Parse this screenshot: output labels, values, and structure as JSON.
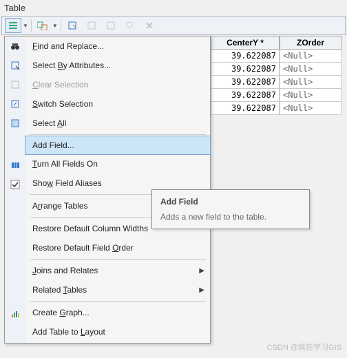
{
  "title": "Table",
  "toolbar": {
    "items": [
      {
        "name": "table-options",
        "icon": "list"
      },
      {
        "name": "related-tables",
        "icon": "related"
      },
      {
        "name": "select-by-attr",
        "icon": "select"
      },
      {
        "name": "switch-select",
        "icon": "switch"
      },
      {
        "name": "clear-select",
        "icon": "clear"
      },
      {
        "name": "zoom-select",
        "icon": "zoom"
      },
      {
        "name": "delete",
        "icon": "x"
      }
    ]
  },
  "menu": {
    "items": [
      {
        "label": "Find and Replace...",
        "icon": "binoculars",
        "key": "F"
      },
      {
        "label": "Select By Attributes...",
        "icon": "select",
        "key": "B"
      },
      {
        "label": "Clear Selection",
        "icon": "clear",
        "disabled": true,
        "key": "C"
      },
      {
        "label": "Switch Selection",
        "icon": "switch",
        "key": "S"
      },
      {
        "label": "Select All",
        "icon": "selectall",
        "key": "A"
      },
      {
        "sep": true
      },
      {
        "label": "Add Field...",
        "icon": "",
        "highlight": true
      },
      {
        "label": "Turn All Fields On",
        "icon": "fields",
        "key": "T"
      },
      {
        "label": "Show Field Aliases",
        "icon": "check",
        "checked": true,
        "key": "w"
      },
      {
        "sep": true
      },
      {
        "label": "Arrange Tables",
        "arrow": true,
        "key": "r"
      },
      {
        "sep": true
      },
      {
        "label": "Restore Default Column Widths"
      },
      {
        "label": "Restore Default Field Order",
        "key": "O"
      },
      {
        "sep": true
      },
      {
        "label": "Joins and Relates",
        "arrow": true,
        "key": "J"
      },
      {
        "label": "Related Tables",
        "arrow": true,
        "key": "T"
      },
      {
        "sep": true
      },
      {
        "label": "Create Graph...",
        "icon": "graph",
        "key": "G"
      },
      {
        "label": "Add Table to Layout",
        "key": "L"
      }
    ]
  },
  "tooltip": {
    "title": "Add Field",
    "body": "Adds a new field to the table."
  },
  "table": {
    "columns": [
      "CenterY *",
      "ZOrder"
    ],
    "rows": [
      {
        "y": "39.622087",
        "z": "<Null>"
      },
      {
        "y": "39.622087",
        "z": "<Null>"
      },
      {
        "y": "39.622087",
        "z": "<Null>"
      },
      {
        "y": "39.622087",
        "z": "<Null>"
      },
      {
        "y": "39.622087",
        "z": "<Null>"
      }
    ]
  },
  "watermark": "CSDN @疯狂学习GIS"
}
